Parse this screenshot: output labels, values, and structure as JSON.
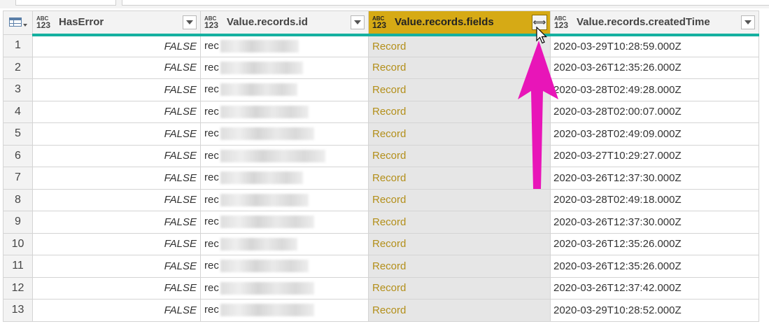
{
  "columns": [
    {
      "type_top": "ABC",
      "type_bottom": "123",
      "label": "HasError"
    },
    {
      "type_top": "ABC",
      "type_bottom": "123",
      "label": "Value.records.id"
    },
    {
      "type_top": "ABC",
      "type_bottom": "123",
      "label": "Value.records.fields",
      "expand_glyph": "⟺"
    },
    {
      "type_top": "ABC",
      "type_bottom": "123",
      "label": "Value.records.createdTime"
    }
  ],
  "icons": {
    "table_menu": "table-icon",
    "dropdown": "chevron-down-icon",
    "expand": "expand-columns-icon",
    "cursor": "mouse-pointer-icon",
    "annotation": "magenta-arrow-icon"
  },
  "colors": {
    "selected_header": "#d6aa15",
    "record_link": "#b38f1a",
    "quality_bar": "#15b0a0",
    "annotation_arrow": "#e815b8"
  },
  "rows": [
    {
      "num": "1",
      "has_error": "FALSE",
      "id_prefix": "rec",
      "fields": "Record",
      "created": "2020-03-29T10:28:59.000Z"
    },
    {
      "num": "2",
      "has_error": "FALSE",
      "id_prefix": "rec",
      "fields": "Record",
      "created": "2020-03-26T12:35:26.000Z"
    },
    {
      "num": "3",
      "has_error": "FALSE",
      "id_prefix": "rec",
      "fields": "Record",
      "created": "2020-03-28T02:49:28.000Z"
    },
    {
      "num": "4",
      "has_error": "FALSE",
      "id_prefix": "rec",
      "fields": "Record",
      "created": "2020-03-28T02:00:07.000Z"
    },
    {
      "num": "5",
      "has_error": "FALSE",
      "id_prefix": "rec",
      "fields": "Record",
      "created": "2020-03-28T02:49:09.000Z"
    },
    {
      "num": "6",
      "has_error": "FALSE",
      "id_prefix": "rec",
      "fields": "Record",
      "created": "2020-03-27T10:29:27.000Z"
    },
    {
      "num": "7",
      "has_error": "FALSE",
      "id_prefix": "rec",
      "fields": "Record",
      "created": "2020-03-26T12:37:30.000Z"
    },
    {
      "num": "8",
      "has_error": "FALSE",
      "id_prefix": "rec",
      "fields": "Record",
      "created": "2020-03-28T02:49:18.000Z"
    },
    {
      "num": "9",
      "has_error": "FALSE",
      "id_prefix": "rec",
      "fields": "Record",
      "created": "2020-03-26T12:37:30.000Z"
    },
    {
      "num": "10",
      "has_error": "FALSE",
      "id_prefix": "rec",
      "fields": "Record",
      "created": "2020-03-26T12:35:26.000Z"
    },
    {
      "num": "11",
      "has_error": "FALSE",
      "id_prefix": "rec",
      "fields": "Record",
      "created": "2020-03-26T12:35:26.000Z"
    },
    {
      "num": "12",
      "has_error": "FALSE",
      "id_prefix": "rec",
      "fields": "Record",
      "created": "2020-03-26T12:37:42.000Z"
    },
    {
      "num": "13",
      "has_error": "FALSE",
      "id_prefix": "rec",
      "fields": "Record",
      "created": "2020-03-29T10:28:52.000Z"
    }
  ]
}
